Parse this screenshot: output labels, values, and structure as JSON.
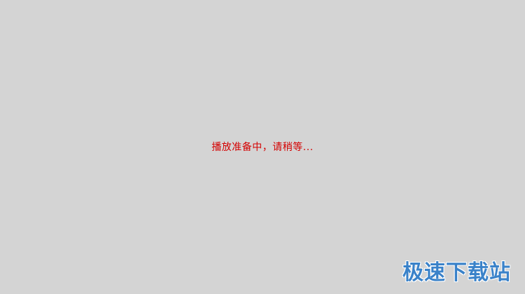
{
  "player": {
    "loading_message": "播放准备中，请稍等...",
    "background_color": "#d4d4d4",
    "message_color": "#d40000"
  },
  "watermark": {
    "text": "极速下载站",
    "color": "#3a82c9"
  }
}
